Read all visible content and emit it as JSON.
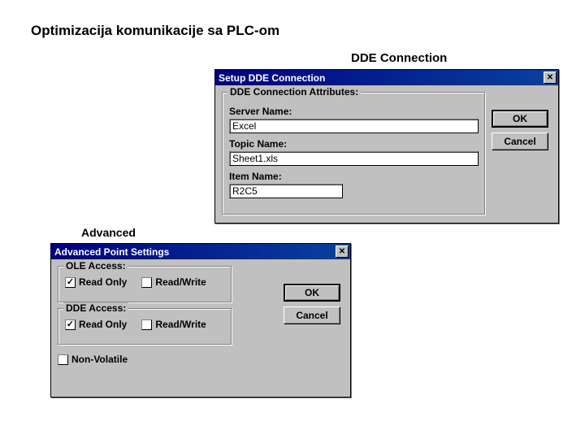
{
  "page": {
    "title": "Optimizacija komunikacije sa PLC-om"
  },
  "labels": {
    "dde_section": "DDE Connection",
    "advanced_section": "Advanced"
  },
  "dde_dialog": {
    "title": "Setup DDE Connection",
    "group_legend": "DDE Connection Attributes:",
    "server_label": "Server Name:",
    "server_value": "Excel",
    "topic_label": "Topic Name:",
    "topic_value": "Sheet1.xls",
    "item_label": "Item Name:",
    "item_value": "R2C5",
    "ok": "OK",
    "cancel": "Cancel"
  },
  "adv_dialog": {
    "title": "Advanced Point Settings",
    "ole_legend": "OLE Access:",
    "dde_legend": "DDE Access:",
    "read_only": "Read Only",
    "read_write": "Read/Write",
    "non_volatile": "Non-Volatile",
    "ok": "OK",
    "cancel": "Cancel"
  }
}
